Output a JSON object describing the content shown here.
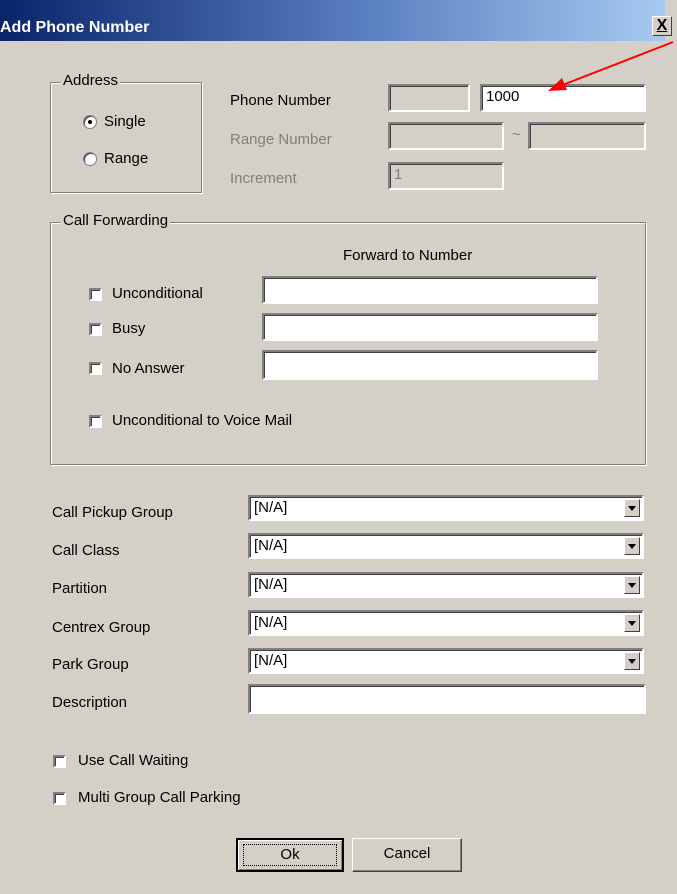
{
  "window": {
    "title": "Add Phone Number",
    "close_icon": "close-icon",
    "close_label": "X"
  },
  "address": {
    "legend": "Address",
    "options": [
      {
        "label": "Single",
        "checked": true
      },
      {
        "label": "Range",
        "checked": false
      }
    ],
    "phone_number_label": "Phone Number",
    "phone_prefix_value": "",
    "phone_number_value": "1000",
    "range_number_label": "Range Number",
    "range_start_value": "",
    "range_separator": "~",
    "range_end_value": "",
    "increment_label": "Increment",
    "increment_value": "1"
  },
  "call_forwarding": {
    "legend": "Call Forwarding",
    "column_header": "Forward to Number",
    "rows": [
      {
        "label": "Unconditional",
        "checked": false,
        "value": ""
      },
      {
        "label": "Busy",
        "checked": false,
        "value": ""
      },
      {
        "label": "No Answer",
        "checked": false,
        "value": ""
      }
    ],
    "voicemail_label": "Unconditional to Voice Mail",
    "voicemail_checked": false
  },
  "settings": {
    "call_pickup_group": {
      "label": "Call Pickup Group",
      "value": "[N/A]"
    },
    "call_class": {
      "label": "Call Class",
      "value": "[N/A]"
    },
    "partition": {
      "label": "Partition",
      "value": "[N/A]"
    },
    "centrex_group": {
      "label": "Centrex Group",
      "value": "[N/A]"
    },
    "park_group": {
      "label": "Park Group",
      "value": "[N/A]"
    },
    "description": {
      "label": "Description",
      "value": ""
    }
  },
  "options": {
    "use_call_waiting": {
      "label": "Use Call Waiting",
      "checked": false
    },
    "multi_group_call_parking": {
      "label": "Multi Group Call Parking",
      "checked": false
    }
  },
  "buttons": {
    "ok": "Ok",
    "cancel": "Cancel"
  },
  "annotation": {
    "arrow_color": "#ff0000",
    "arrow_icon": "red-arrow-icon"
  },
  "colors": {
    "dialog_bg": "#d4d0c8",
    "title_gradient_start": "#0a246a",
    "title_gradient_end": "#a6caf0"
  }
}
